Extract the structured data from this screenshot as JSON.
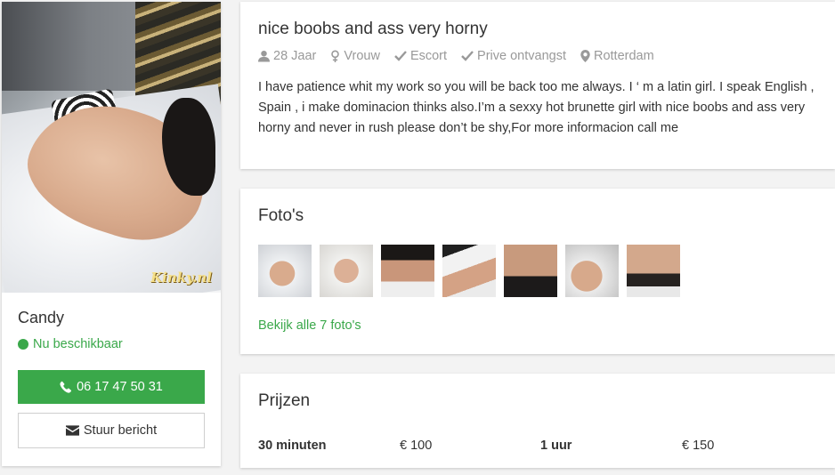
{
  "profile": {
    "name": "Candy",
    "status": "Nu beschikbaar",
    "watermark": "Kinky.nl",
    "phone_button": "06 17 47 50 31",
    "message_button": "Stuur bericht",
    "colors": {
      "green": "#3aa84a"
    }
  },
  "about": {
    "title": "nice boobs and ass very horny",
    "meta": {
      "age": "28 Jaar",
      "gender": "Vrouw",
      "type": "Escort",
      "location_type": "Prive ontvangst",
      "city": "Rotterdam"
    },
    "description": "I have patience whit my work so you will be back too me always. I ‘ m a latin girl. I speak English , Spain , i make dominacion thinks also.I’m a sexxy hot brunette girl with nice boobs and ass very horny and never in rush please don’t be shy,For more informacion call me"
  },
  "photos": {
    "title": "Foto's",
    "thumbnail_count": 7,
    "view_all": "Bekijk alle 7 foto's"
  },
  "prices": {
    "title": "Prijzen",
    "items": [
      {
        "duration": "30 minuten",
        "price": "€ 100"
      },
      {
        "duration": "1 uur",
        "price": "€ 150"
      }
    ]
  }
}
